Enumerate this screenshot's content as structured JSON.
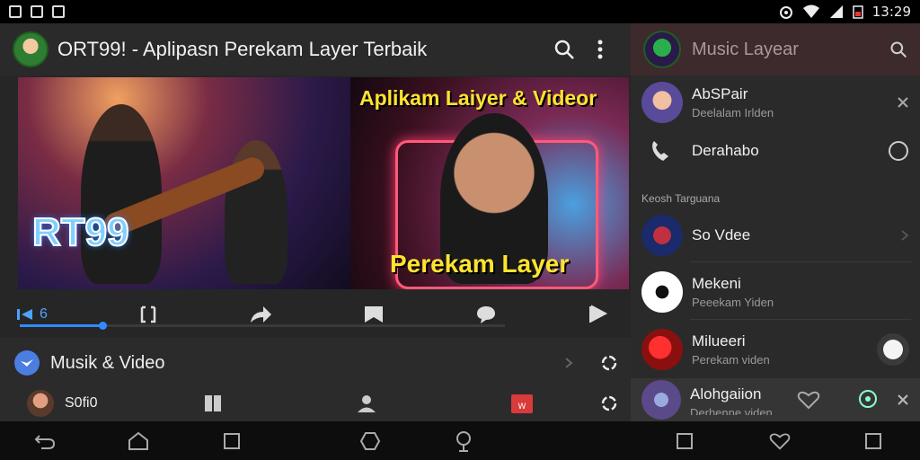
{
  "status_bar": {
    "time": "13:29"
  },
  "app_bar": {
    "title": "ORT99! - Aplipasn Perekam Layer Terbaik"
  },
  "thumbnails": [
    {
      "overlay_text": "RT99"
    },
    {
      "top_text": "Aplikam Laiyer & Videor",
      "bottom_text": "Perekam Layer"
    }
  ],
  "toolbar": {
    "counter": "6",
    "progress": 0.17
  },
  "section": {
    "title": "Musik & Video",
    "sub_label": "S0fi0"
  },
  "drawer": {
    "title": "Music Layear",
    "items": [
      {
        "title": "AbSPair",
        "subtitle": "Deelalam Irlden"
      },
      {
        "title": "Derahabo"
      }
    ],
    "section_label": "Keosh Targuana",
    "list": [
      {
        "title": "So Vdee"
      },
      {
        "title": "Mekeni",
        "subtitle": "Peeekam Yiden"
      },
      {
        "title": "Milueeri",
        "subtitle": "Perekam viden"
      },
      {
        "title": "Alohgaiion",
        "subtitle": "Derhenne viden"
      }
    ]
  },
  "colors": {
    "accent": "#2e8cff",
    "drawer_header": "#3d2a2c",
    "yellow_text": "#ffe330"
  }
}
